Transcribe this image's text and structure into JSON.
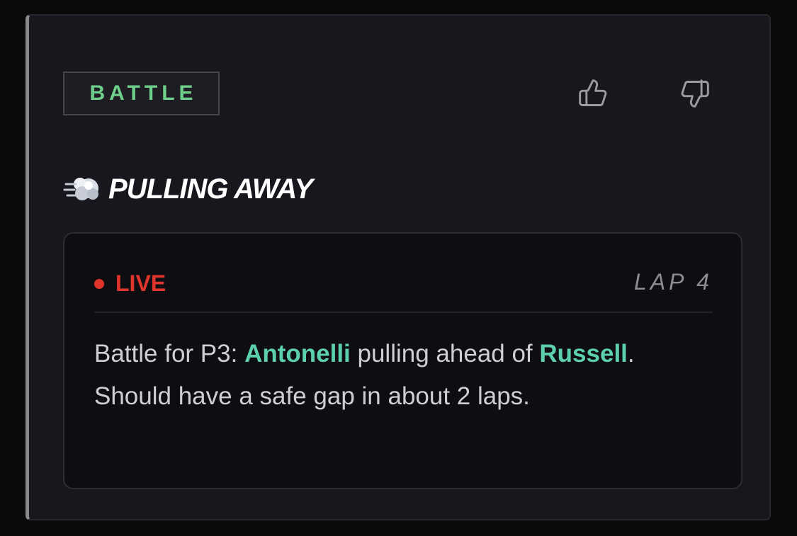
{
  "card": {
    "tag": "BATTLE",
    "title": "PULLING AWAY",
    "icons": {
      "emoji": "dash-symbol-icon",
      "upvote": "thumbs-up-icon",
      "downvote": "thumbs-down-icon"
    }
  },
  "update": {
    "status": "LIVE",
    "lap": "LAP 4",
    "message": {
      "prefix": "Battle for P3: ",
      "driver1": "Antonelli",
      "middle": " pulling ahead of ",
      "driver2": "Russell",
      "suffix": ". Should have a safe gap in about 2 laps."
    }
  },
  "colors": {
    "tag_text": "#6fd08c",
    "live": "#e0352b",
    "driver": "#5ccfae",
    "card_bg": "#17171d",
    "inner_bg": "#0e0e12"
  }
}
